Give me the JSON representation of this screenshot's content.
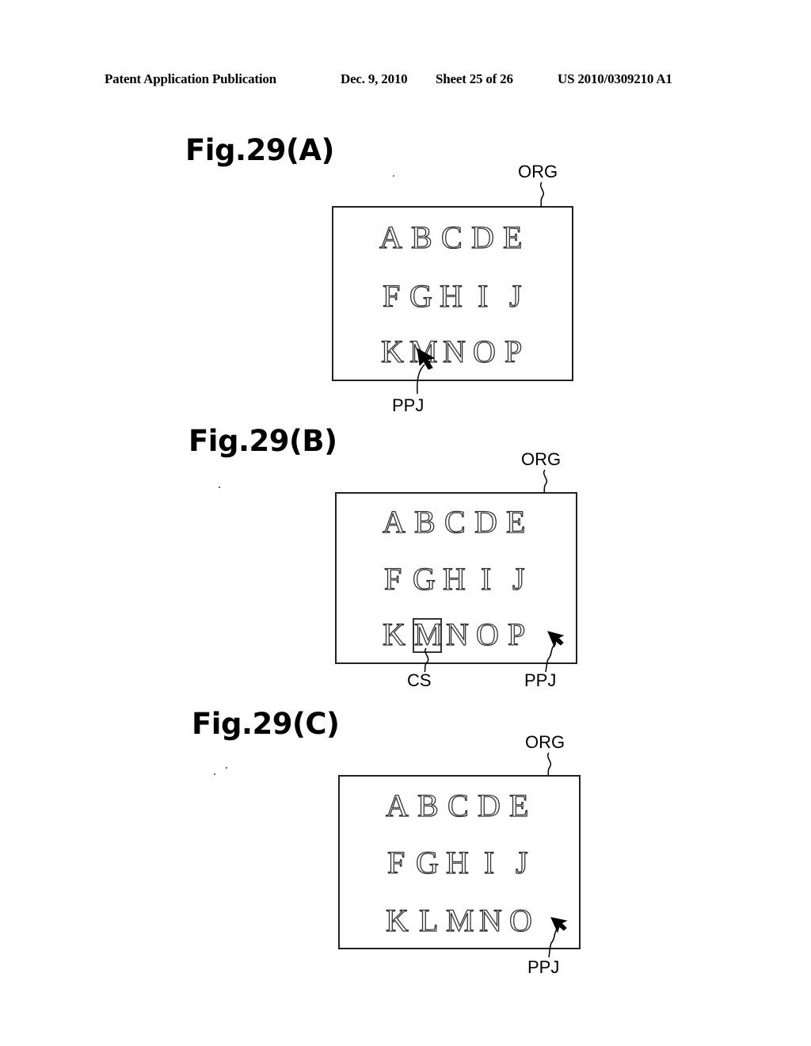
{
  "header": {
    "publication": "Patent Application Publication",
    "date": "Dec. 9, 2010",
    "sheet": "Sheet 25 of 26",
    "number": "US 2010/0309210 A1"
  },
  "figures": [
    {
      "title": "Fig.29(A)",
      "org_label": "ORG",
      "rows": [
        [
          "A",
          "B",
          "C",
          "D",
          "E"
        ],
        [
          "F",
          "G",
          "H",
          "I",
          "J"
        ],
        [
          "K",
          "M",
          "N",
          "O",
          "P"
        ]
      ],
      "pointer_label": "PPJ"
    },
    {
      "title": "Fig.29(B)",
      "org_label": "ORG",
      "rows": [
        [
          "A",
          "B",
          "C",
          "D",
          "E"
        ],
        [
          "F",
          "G",
          "H",
          "I",
          "J"
        ],
        [
          "K",
          "M",
          "N",
          "O",
          "P"
        ]
      ],
      "cs_label": "CS",
      "pointer_label": "PPJ"
    },
    {
      "title": "Fig.29(C)",
      "org_label": "ORG",
      "rows": [
        [
          "A",
          "B",
          "C",
          "D",
          "E"
        ],
        [
          "F",
          "G",
          "H",
          "I",
          "J"
        ],
        [
          "K",
          "L",
          "M",
          "N",
          "O"
        ]
      ],
      "pointer_label": "PPJ"
    }
  ],
  "icons": {
    "pointer": "arrow-cursor-icon",
    "leader": "squiggle-leader-line"
  }
}
